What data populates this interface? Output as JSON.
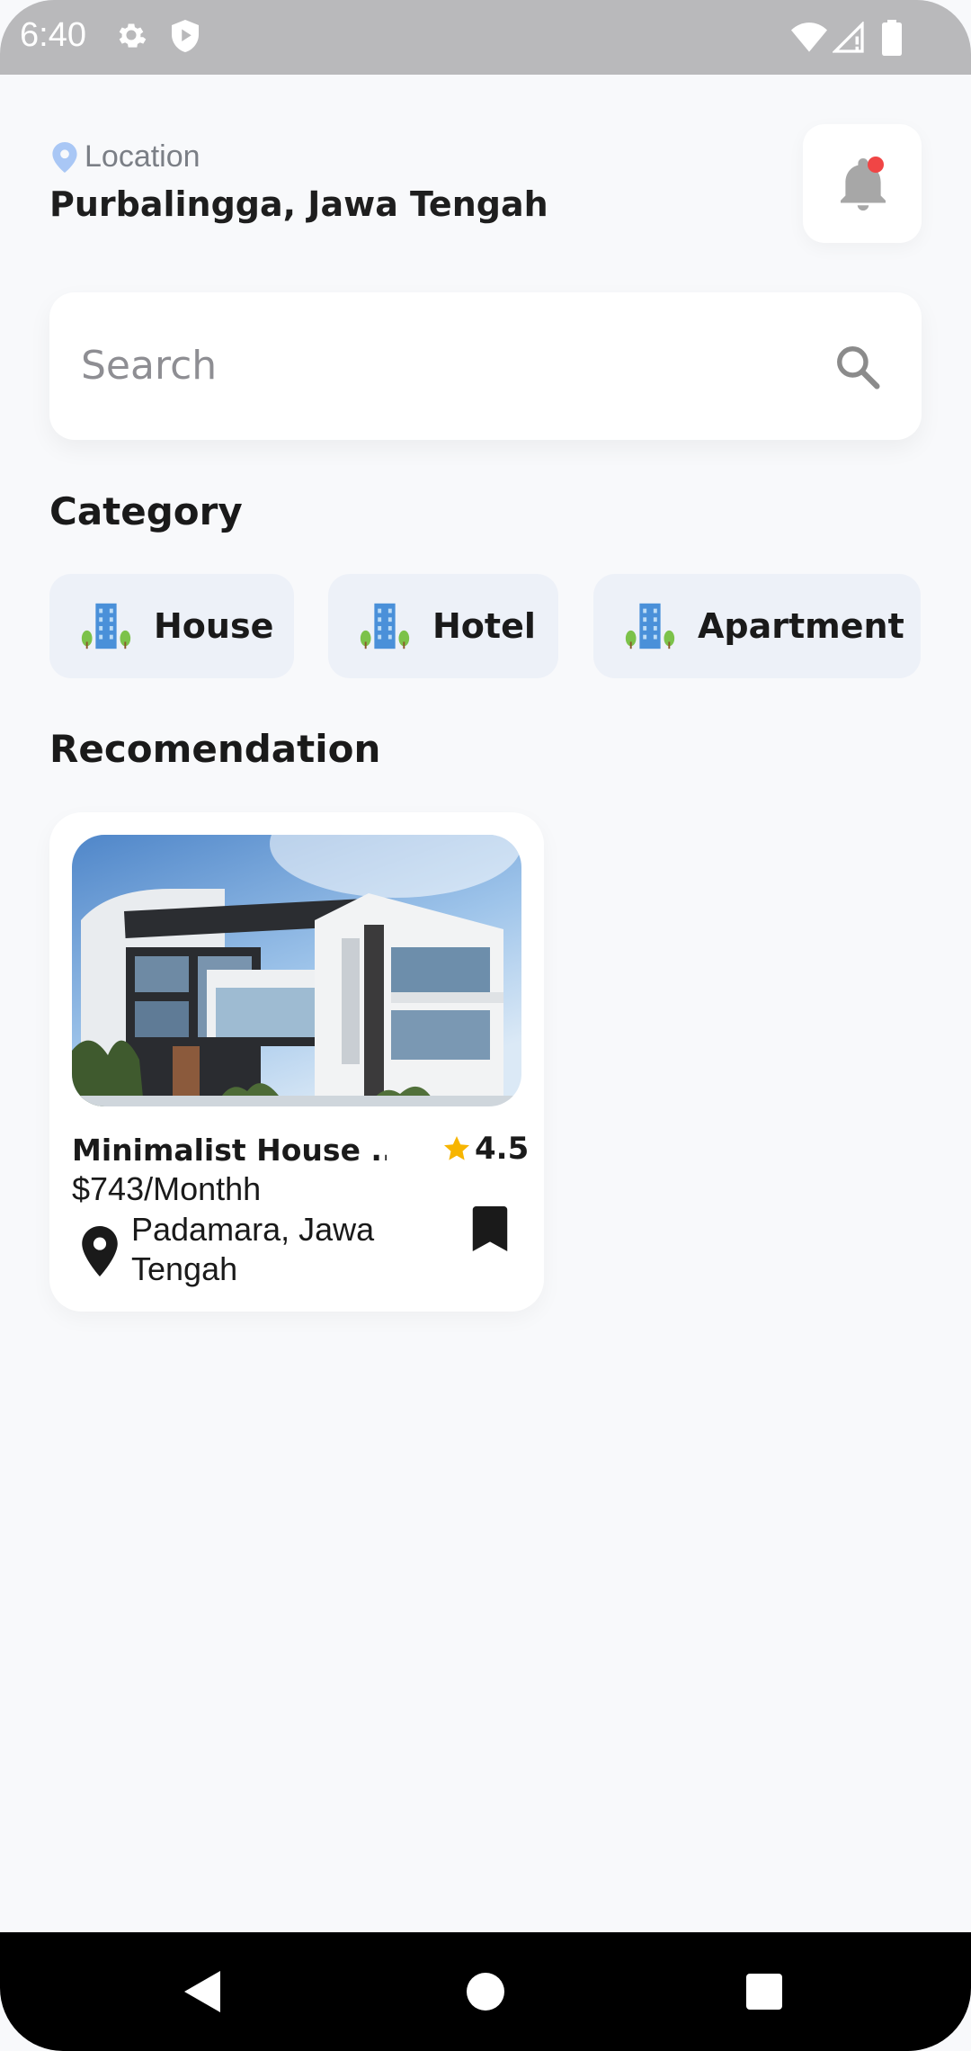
{
  "status_bar": {
    "time": "6:40",
    "icons": [
      "gear-icon",
      "shield-play-icon",
      "wifi-icon",
      "signal-icon",
      "battery-icon"
    ]
  },
  "header": {
    "location_label": "Location",
    "location_value": "Purbalingga, Jawa Tengah",
    "notification": {
      "icon": "bell-icon",
      "has_unread": true,
      "dot_color": "#f04545"
    }
  },
  "search": {
    "placeholder": "Search",
    "value": "",
    "icon": "search-icon"
  },
  "category": {
    "title": "Category",
    "items": [
      {
        "label": "House",
        "icon": "building-icon"
      },
      {
        "label": "Hotel",
        "icon": "building-icon"
      },
      {
        "label": "Apartment",
        "icon": "building-icon"
      }
    ]
  },
  "recommendation": {
    "title": "Recomendation",
    "items": [
      {
        "title": "Minimalist House ...",
        "rating": "4.5",
        "price": "$743/Monthh",
        "location": "Padamara, Jawa Tengah",
        "image": "modern-house-photo",
        "bookmarked": true
      }
    ]
  },
  "nav_bar": {
    "buttons": [
      "back-icon",
      "home-icon",
      "recents-icon"
    ]
  },
  "colors": {
    "background": "#f8f9fb",
    "chip_background": "#edf1f8",
    "star": "#f7b500",
    "location_pin": "#a9c7f5",
    "notification_dot": "#f04545"
  }
}
